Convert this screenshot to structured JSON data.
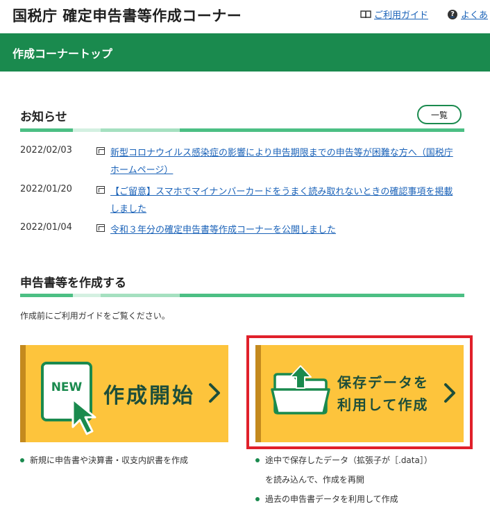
{
  "header": {
    "title": "国税庁 確定申告書等作成コーナー",
    "guide_link": "ご利用ガイド",
    "faq_link": "よくあ"
  },
  "nav": {
    "title": "作成コーナートップ"
  },
  "news": {
    "heading": "お知らせ",
    "more_button": "一覧",
    "items": [
      {
        "date": "2022/02/03",
        "text": "新型コロナウイルス感染症の影響により申告期限までの申告等が困難な方へ（国税庁ホームページ）"
      },
      {
        "date": "2022/01/20",
        "text": "【ご留意】スマホでマイナンバーカードをうまく読み取れないときの確認事項を掲載しました"
      },
      {
        "date": "2022/01/04",
        "text": "令和３年分の確定申告書等作成コーナーを公開しました"
      }
    ]
  },
  "create": {
    "heading": "申告書等を作成する",
    "intro": "作成前にご利用ガイドをご覧ください。",
    "new_card": {
      "badge": "NEW",
      "label": "作成開始",
      "bullets": [
        "新規に申告書や決算書・収支内訳書を作成"
      ]
    },
    "saved_card": {
      "label_line1": "保存データを",
      "label_line2": "利用して作成",
      "bullets": [
        {
          "line1": "途中で保存したデータ（拡張子が［.data］）",
          "line2": "を読み込んで、作成を再開"
        },
        {
          "line1": "過去の申告書データを利用して作成"
        }
      ]
    }
  },
  "colors": {
    "brand_green": "#1a8a4e",
    "card_yellow": "#fdc43c",
    "link_blue": "#1a62b8",
    "highlight_red": "#e0202a"
  }
}
